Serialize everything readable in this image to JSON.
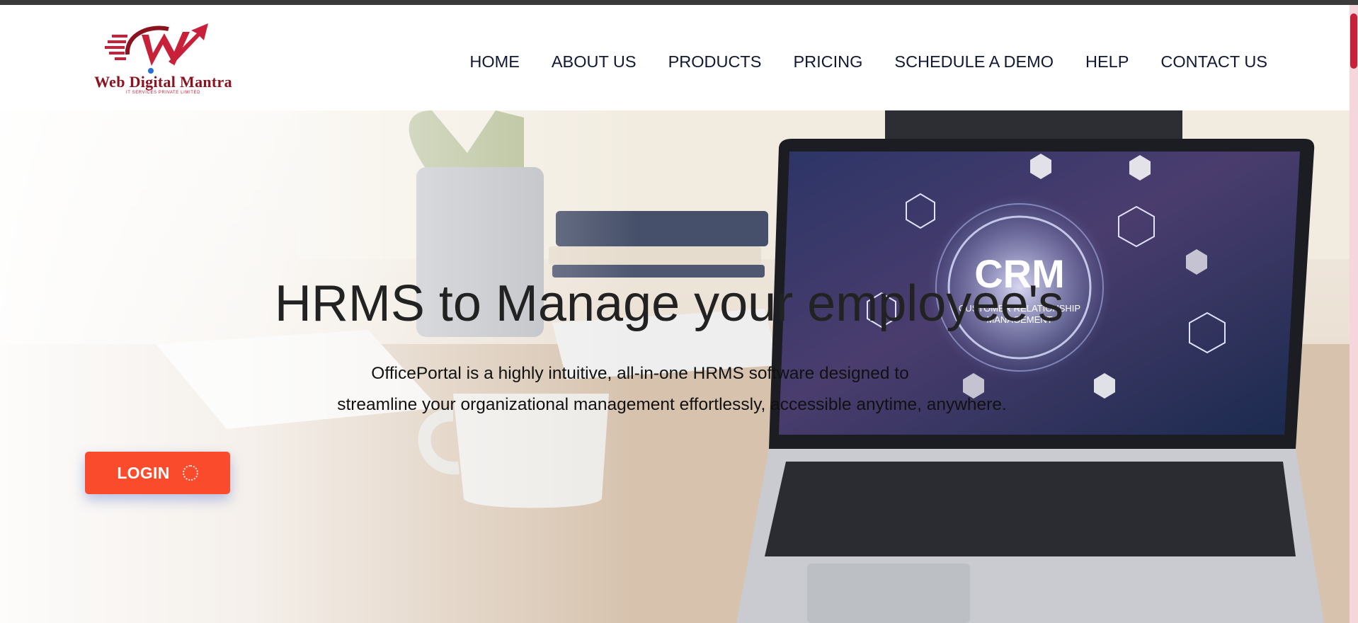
{
  "brand": {
    "name": "Web Digital Mantra",
    "tagline": "IT SERVICES PRIVATE LIMITED",
    "logo_icon": "w-arrow-logo-icon",
    "primary_color": "#c9203a"
  },
  "nav": {
    "items": [
      {
        "label": "HOME"
      },
      {
        "label": "ABOUT US"
      },
      {
        "label": "PRODUCTS"
      },
      {
        "label": "PRICING"
      },
      {
        "label": "SCHEDULE A DEMO"
      },
      {
        "label": "HELP"
      },
      {
        "label": "CONTACT US"
      }
    ],
    "text_color": "#101834"
  },
  "hero": {
    "title": "HRMS to Manage your employee's",
    "description_line1": "OfficePortal is a highly intuitive, all-in-one HRMS software designed to",
    "description_line2": "streamline your organizational management effortlessly, accessible anytime, anywhere.",
    "background_image": "laptop-on-desk-with-crm-screen",
    "screen_text_main": "CRM",
    "screen_text_line1": "CUSTOMER RELATIONSHIP",
    "screen_text_line2": "MANAGEMENT",
    "login_button": {
      "label": "LOGIN",
      "icon": "spinner-icon",
      "color": "#fa4b2c"
    }
  }
}
